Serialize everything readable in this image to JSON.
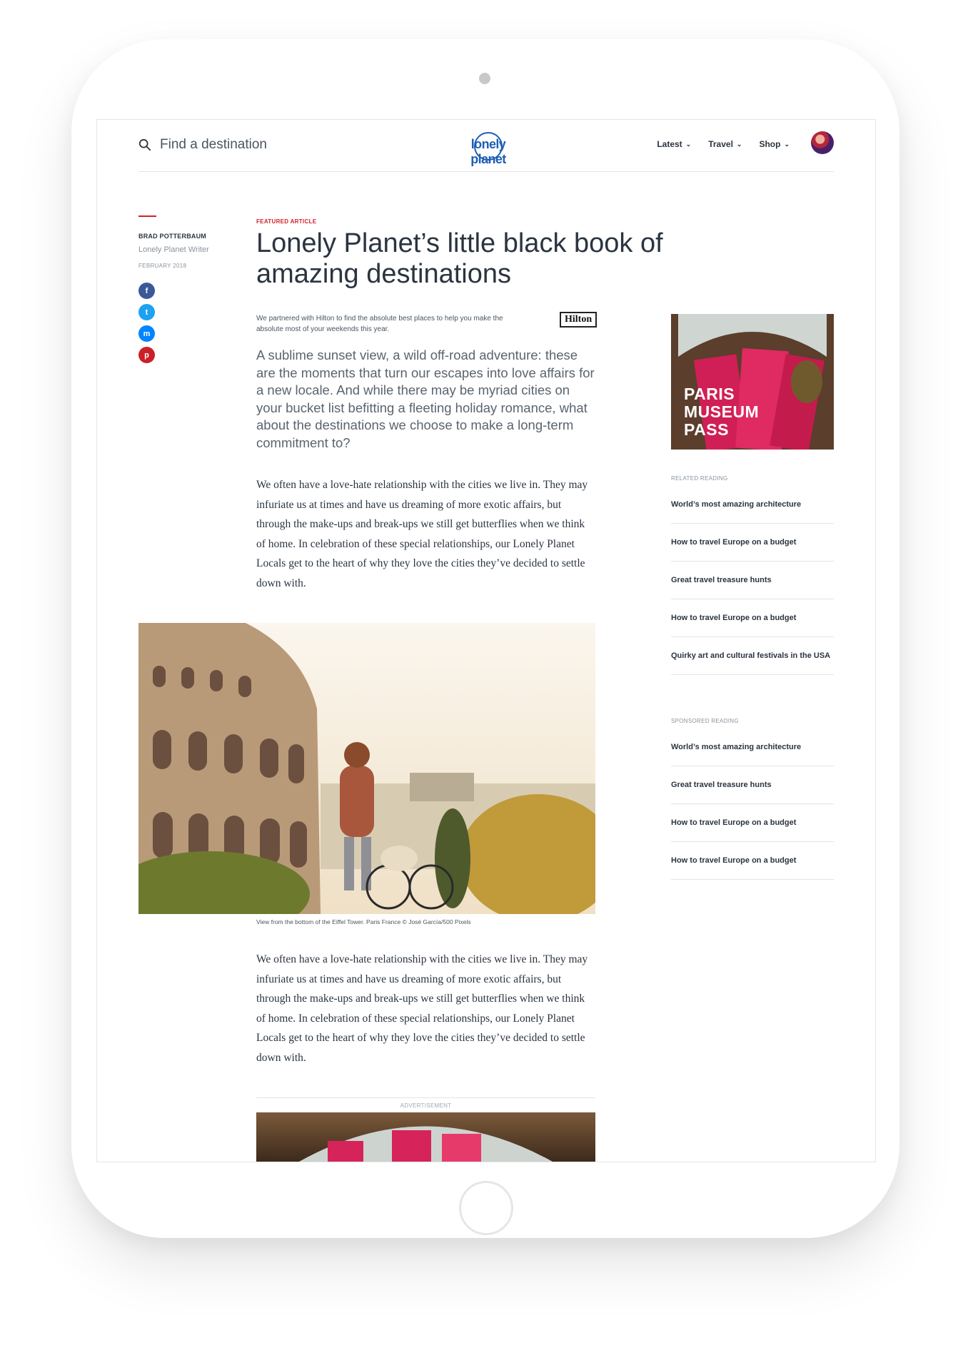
{
  "header": {
    "search_placeholder": "Find a destination",
    "logo_text": "lonely planet",
    "nav": [
      {
        "label": "Latest"
      },
      {
        "label": "Travel"
      },
      {
        "label": "Shop"
      }
    ]
  },
  "author": {
    "name": "BRAD POTTERBAUM",
    "role": "Lonely Planet Writer",
    "date": "FEBRUARY 2018"
  },
  "share_icons": [
    "facebook-icon",
    "twitter-icon",
    "messenger-icon",
    "pinterest-icon"
  ],
  "share_glyphs": {
    "facebook": "f",
    "twitter": "t",
    "messenger": "m",
    "pinterest": "p"
  },
  "article": {
    "kicker": "FEATURED ARTICLE",
    "title": "Lonely Planet’s little black book of amazing destinations",
    "sponsor_note": "We partnered with Hilton to find the absolute best places to help you make the absolute most of your weekends this year.",
    "sponsor_logo": "Hilton",
    "lede": "A sublime sunset view, a wild off-road adventure: these are the moments that turn our escapes into love affairs for a new locale. And while there may be myriad cities on your bucket list befitting a fleeting holiday romance, what about the destinations we choose to make a long-term commitment to?",
    "body_1": "We often have a love-hate relationship with the cities we live in. They may infuriate us at times and have us dreaming of more exotic affairs, but through the make-ups and break-ups we still get butterflies when we think of home. In celebration of these special relationships, our Lonely Planet Locals get to the heart of why they love the cities they’ve decided to settle down with.",
    "caption": "View from the bottom of the Eiffel Tower. Paris France © José García/500 Pixels",
    "body_2": "We often have a love-hate relationship with the cities we live in. They may infuriate us at times and have us dreaming of more exotic affairs, but through the make-ups and break-ups we still get butterflies when we think of home. In celebration of these special relationships, our Lonely Planet Locals get to the heart of why they love the cities they’ve decided to settle down with.",
    "ad_label": "ADVERTISEMENT"
  },
  "sidebar": {
    "ad_title": "PARIS MUSEUM PASS",
    "related_label": "RELATED READING",
    "related": [
      {
        "label": "World’s most amazing architecture"
      },
      {
        "label": "How to travel Europe on a budget"
      },
      {
        "label": "Great travel treasure hunts"
      },
      {
        "label": "How to travel Europe on a budget"
      },
      {
        "label": "Quirky art and cultural festivals in the USA"
      }
    ],
    "sponsored_label": "SPONSORED READING",
    "sponsored": [
      {
        "label": "World’s most amazing architecture"
      },
      {
        "label": "Great travel treasure hunts"
      },
      {
        "label": "How to travel Europe on a budget"
      },
      {
        "label": "How to travel Europe on a budget"
      }
    ]
  },
  "colors": {
    "accent_red": "#d0222a",
    "brand_blue": "#1f5fb4",
    "text_dark": "#2b3440",
    "text_muted": "#8a939c"
  }
}
